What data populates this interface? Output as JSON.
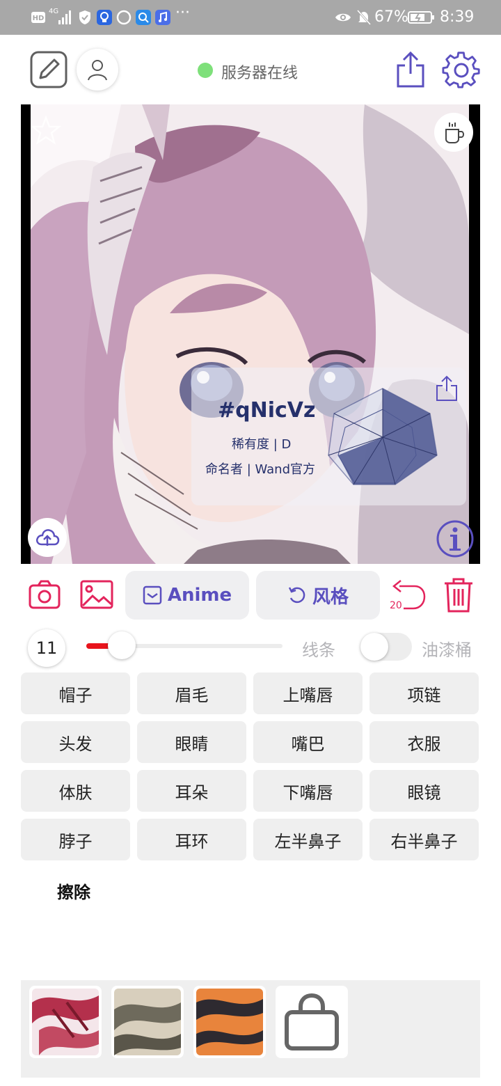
{
  "status_bar": {
    "network": "4G",
    "battery": "67%",
    "time": "8:39"
  },
  "header": {
    "server_status": "服务器在线"
  },
  "card": {
    "id": "#qNicVz",
    "rarity": "稀有度 | D",
    "namer": "命名者 | Wand官方"
  },
  "toolbar": {
    "mode_label": "Anime",
    "style_label": "风格",
    "undo_count": "20"
  },
  "brush": {
    "size": "11",
    "size_fraction": 0.18,
    "line_label": "线条",
    "bucket_label": "油漆桶",
    "bucket_enabled": false
  },
  "labels": [
    "帽子",
    "眉毛",
    "上嘴唇",
    "项链",
    "头发",
    "眼睛",
    "嘴巴",
    "衣服",
    "体肤",
    "耳朵",
    "下嘴唇",
    "眼镜",
    "脖子",
    "耳环",
    "左半鼻子",
    "右半鼻子"
  ],
  "erase_label": "擦除",
  "colors": {
    "accent": "#5a4fbf",
    "danger": "#e3245c",
    "online": "#7ee07a",
    "slider_fill": "#e8141c"
  }
}
